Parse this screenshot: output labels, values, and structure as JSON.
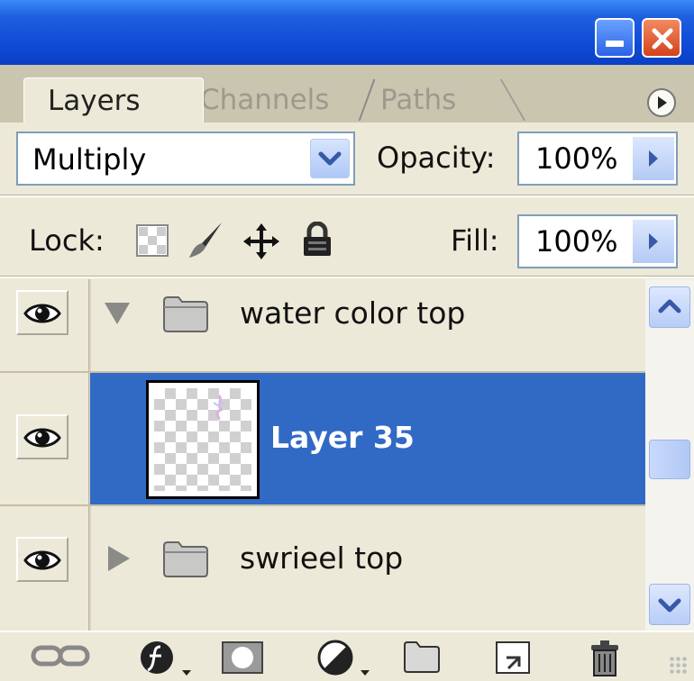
{
  "tabs": [
    {
      "label": "Layers",
      "active": true
    },
    {
      "label": "Channels",
      "active": false
    },
    {
      "label": "Paths",
      "active": false
    }
  ],
  "blend_mode": "Multiply",
  "opacity": {
    "label": "Opacity:",
    "value": "100%"
  },
  "lock": {
    "label": "Lock:",
    "icons": [
      "lock-transparent-pixels-icon",
      "lock-image-pixels-brush-icon",
      "lock-position-move-icon",
      "lock-all-padlock-icon"
    ]
  },
  "fill": {
    "label": "Fill:",
    "value": "100%"
  },
  "layers": [
    {
      "name": "water color top",
      "type": "group",
      "expanded": true,
      "visible": true
    },
    {
      "name": "Layer 35",
      "type": "layer",
      "selected": true,
      "visible": true
    },
    {
      "name": "swrieel top",
      "type": "group",
      "expanded": false,
      "visible": true
    }
  ],
  "bottom_tools": [
    "link-layers-icon",
    "layer-style-icon",
    "layer-mask-icon",
    "adjustment-layer-icon",
    "new-group-icon",
    "new-layer-icon",
    "delete-layer-icon"
  ],
  "colors": {
    "selection": "#316AC5",
    "panel": "#ECE9D8",
    "titlebar": "#0F4AD6"
  }
}
